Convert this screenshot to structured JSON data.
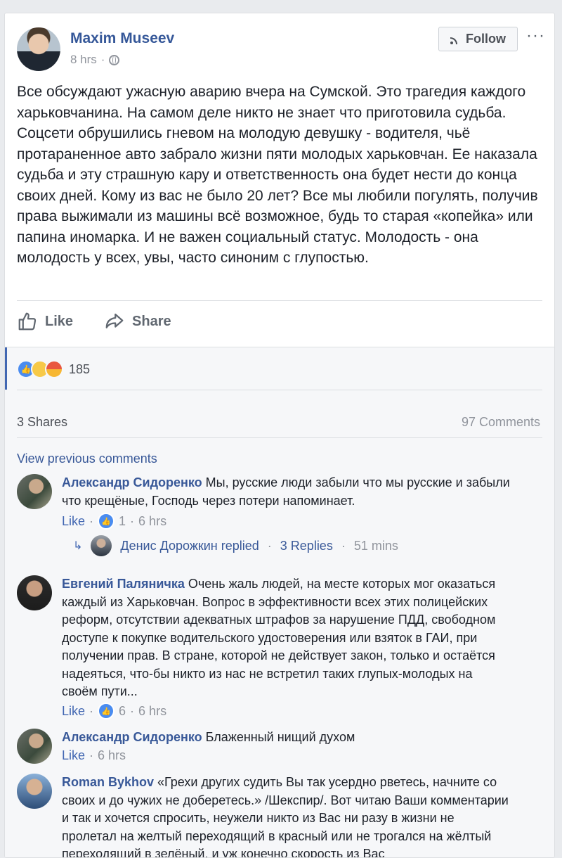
{
  "post": {
    "author": "Maxim Museev",
    "time": "8 hrs",
    "follow_label": "Follow",
    "more": "···",
    "text": "Все обсуждают ужасную аварию вчера на Сумской. Это трагедия каждого харьковчанина. На самом деле никто не знает что приготовила судьба. Соцсети обрушились гневом на молодую девушку - водителя, чьё протараненное авто забрало жизни пяти молодых харьковчан. Ее наказала судьба и эту страшную кару и ответственность она будет нести до конца своих дней. Кому из вас не было 20 лет? Все мы любили погулять, получив права выжимали из машины всё возможное, будь то старая «копейка» или папина иномарка. И не важен социальный статус. Молодость - она молодость у всех, увы, часто синоним с глупостью.",
    "like_label": "Like",
    "share_label": "Share"
  },
  "stats": {
    "reactions_count": "185",
    "shares": "3 Shares",
    "comments": "97 Comments",
    "view_previous": "View previous comments"
  },
  "comments": [
    {
      "author": "Александр Сидоренко",
      "text": "Мы, русские люди забыли что мы русские и забыли что крещёные, Господь через потери напоминает.",
      "like_label": "Like",
      "likes": "1",
      "time": "6 hrs",
      "reply": {
        "author": "Денис Дорожкин replied",
        "replies": "3 Replies",
        "time": "51 mins"
      }
    },
    {
      "author": "Евгений Паляничка",
      "text": "Очень жаль людей, на месте которых мог оказаться каждый из Харьковчан. Вопрос в эффективности всех этих полицейских реформ, отсутствии адекватных штрафов за нарушение ПДД, свободном доступе к покупке водительского удостоверения или взяток в ГАИ, при получении прав. В стране, которой не действует закон, только и остаётся надеяться, что-бы никто из нас не встретил таких глупых-молодых на своём пути...",
      "like_label": "Like",
      "likes": "6",
      "time": "6 hrs"
    },
    {
      "author": "Александр Сидоренко",
      "text": "Блаженный нищий духом",
      "like_label": "Like",
      "time": "6 hrs"
    },
    {
      "author": "Roman Bykhov",
      "text": "«Грехи других судить Вы так усердно рветесь, начните со своих и до чужих не доберетесь.» /Шекспир/. Вот читаю Ваши комментарии и так и хочется спросить, неужели никто из Вас ни разу в жизни не пролетал на желтый переходящий в красный или не трогался на жёлтый переходящий в зелёный, и уж конечно скорость из Вас"
    }
  ]
}
